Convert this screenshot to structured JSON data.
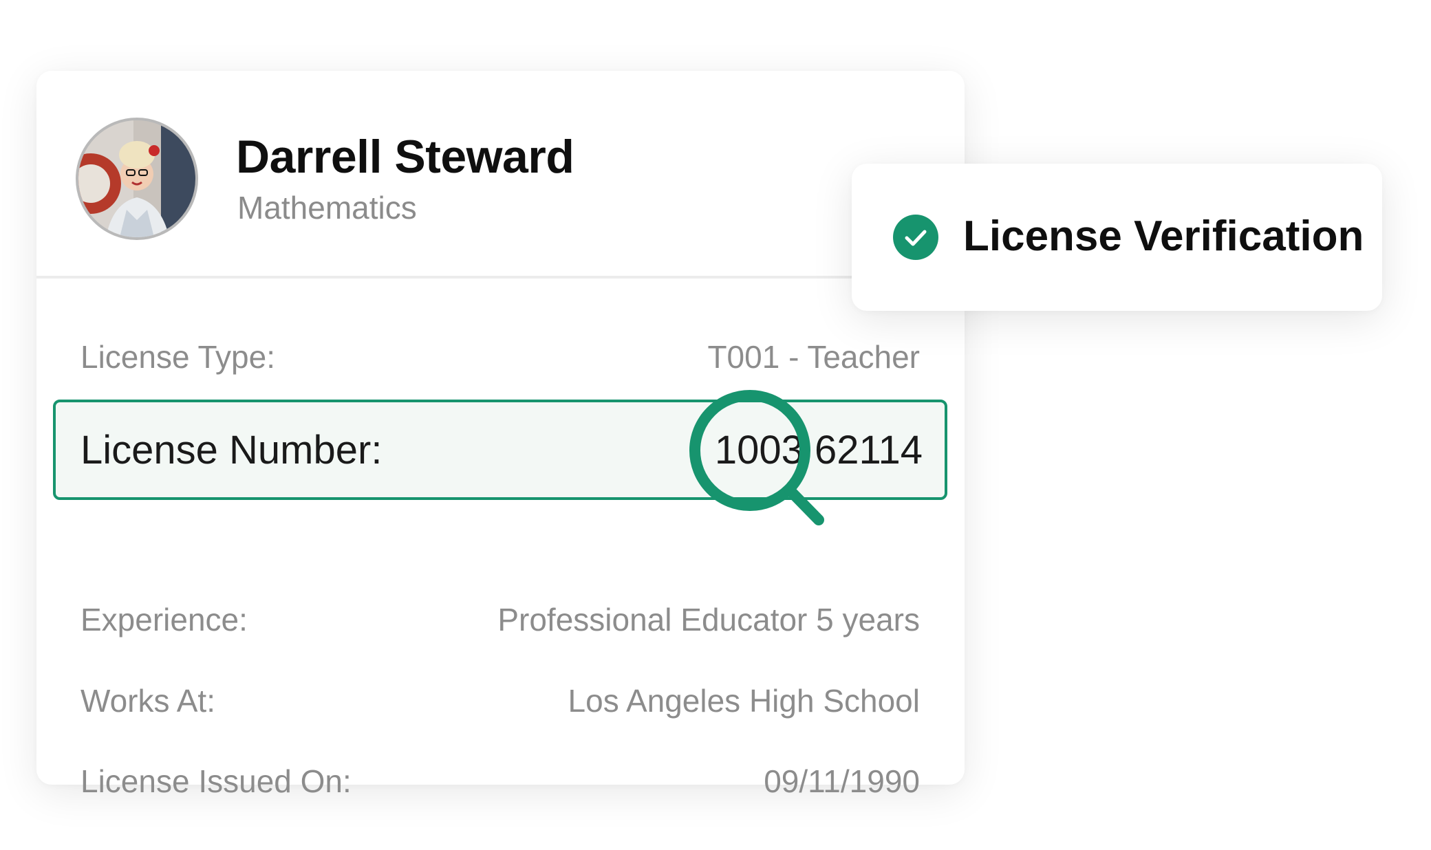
{
  "profile": {
    "name": "Darrell Steward",
    "subject": "Mathematics"
  },
  "details": {
    "license_type": {
      "label": "License Type:",
      "value": "T001 - Teacher"
    },
    "license_number": {
      "label": "License Number:",
      "value": "1003 62114"
    },
    "experience": {
      "label": "Experience:",
      "value": "Professional Educator 5 years"
    },
    "works_at": {
      "label": "Works At:",
      "value": "Los Angeles High School"
    },
    "issued_on": {
      "label": "License Issued On:",
      "value": "09/11/1990"
    }
  },
  "verification": {
    "title": "License Verification",
    "status_icon": "check-circle-icon"
  },
  "colors": {
    "accent": "#17946e",
    "highlight_bg": "#f3f8f5",
    "label_gray": "#8c8c8c",
    "text_dark": "#0f0f0f"
  },
  "icons": {
    "magnifier": "search-icon",
    "avatar": "avatar-photo"
  }
}
